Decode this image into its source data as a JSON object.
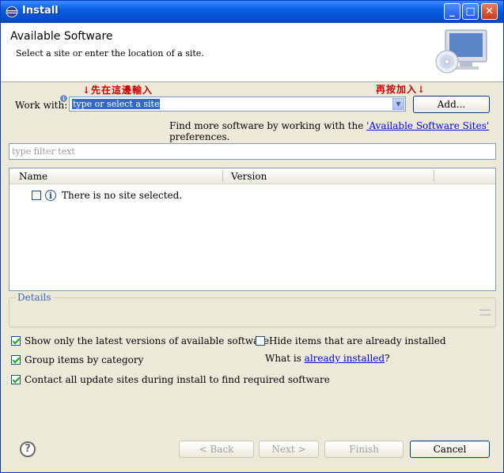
{
  "window": {
    "title": "Install"
  },
  "banner": {
    "title": "Available Software",
    "subtitle": "Select a site or enter the location of a site."
  },
  "annotations": {
    "left_note": "↓先在這邊輸入",
    "right_note": "再按加入↓"
  },
  "work_with": {
    "label": "Work with:",
    "value": "type or select a site",
    "add_button": "Add..."
  },
  "find_more": {
    "prefix": "Find more software by working with the ",
    "link": "'Available Software Sites'",
    "suffix": " preferences."
  },
  "filter": {
    "placeholder": "type filter text"
  },
  "table": {
    "columns": [
      "Name",
      "Version"
    ],
    "rows": [
      {
        "name": "There is no site selected.",
        "checked": false
      }
    ]
  },
  "details": {
    "label": "Details"
  },
  "options": {
    "show_latest": {
      "label": "Show only the latest versions of available software",
      "checked": true
    },
    "group_by_category": {
      "label": "Group items by category",
      "checked": true
    },
    "contact_sites": {
      "label": "Contact all update sites during install to find required software",
      "checked": true
    },
    "hide_installed": {
      "label": "Hide items that are already installed",
      "checked": false
    },
    "what_is": {
      "prefix": "What is ",
      "link": "already installed",
      "suffix": "?"
    }
  },
  "footer": {
    "help": "?",
    "back": "< Back",
    "next": "Next >",
    "finish": "Finish",
    "cancel": "Cancel"
  },
  "colors": {
    "titlebar": "#0552d6",
    "annotation": "#d00000",
    "link": "#0000ee",
    "selection": "#316ac5"
  }
}
